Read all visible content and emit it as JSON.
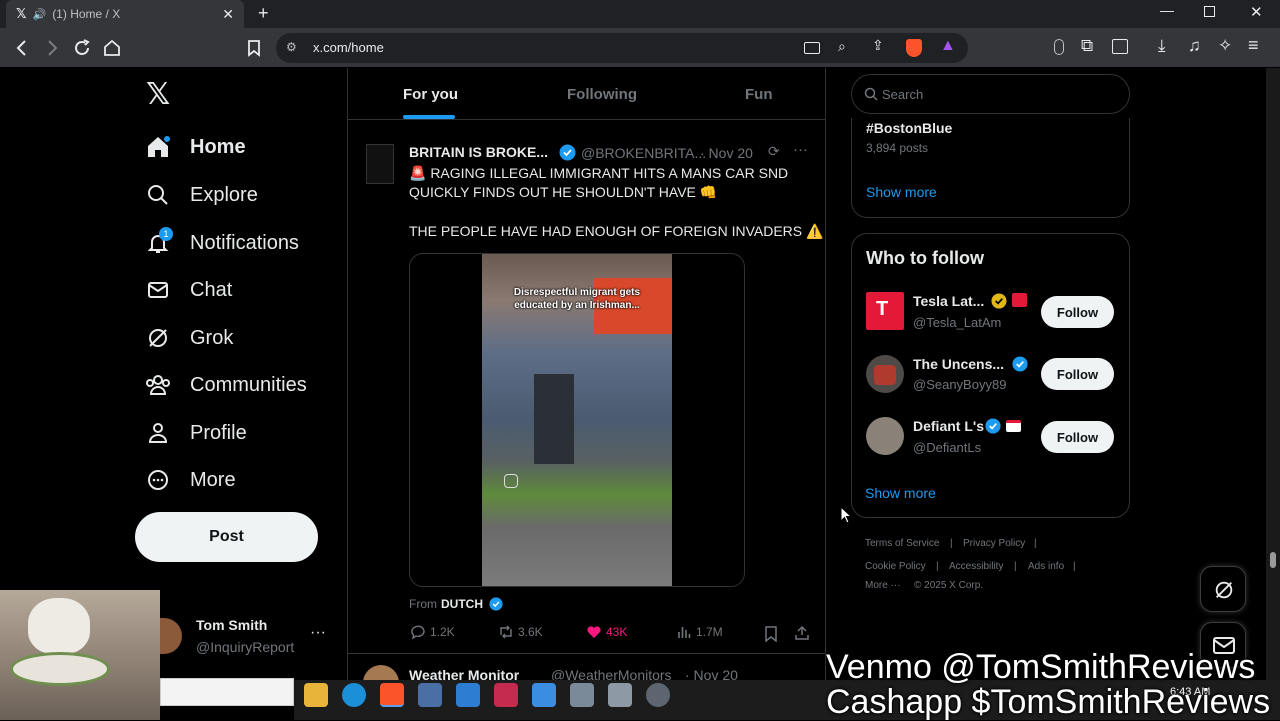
{
  "browser": {
    "tab_title": "(1) Home / X",
    "url": "x.com/home"
  },
  "nav": {
    "items": [
      {
        "label": "Home",
        "icon": "home-icon"
      },
      {
        "label": "Explore",
        "icon": "search-icon"
      },
      {
        "label": "Notifications",
        "icon": "bell-icon",
        "badge": "1"
      },
      {
        "label": "Chat",
        "icon": "envelope-icon"
      },
      {
        "label": "Grok",
        "icon": "grok-icon"
      },
      {
        "label": "Communities",
        "icon": "people-icon"
      },
      {
        "label": "Profile",
        "icon": "person-icon"
      },
      {
        "label": "More",
        "icon": "more-circle-icon"
      }
    ],
    "post_label": "Post",
    "account": {
      "name": "Tom Smith",
      "handle": "@InquiryReport"
    }
  },
  "feed": {
    "tabs": [
      "For you",
      "Following",
      "Fun"
    ],
    "tweet": {
      "author": "BRITAIN IS BROKE...",
      "handle": "@BROKENBRITA...",
      "date": "· Nov 20",
      "line1": "🚨 RAGING ILLEGAL IMMIGRANT HITS A MANS CAR SND QUICKLY FINDS OUT HE SHOULDN'T HAVE 👊",
      "line2": "THE PEOPLE HAVE HAD ENOUGH OF FOREIGN INVADERS ⚠️",
      "video_caption": "Disrespectful migrant gets educated by an Irishman...",
      "from_label": "From",
      "from_name": "DUTCH",
      "replies": "1.2K",
      "reposts": "3.6K",
      "likes": "43K",
      "views": "1.7M"
    },
    "next_tweet": {
      "author": "Weather Monitor",
      "handle": "@WeatherMonitors",
      "date": "· Nov 20"
    }
  },
  "sidebar": {
    "search_placeholder": "Search",
    "trend": {
      "tag": "#BostonBlue",
      "posts": "3,894 posts"
    },
    "show_more": "Show more",
    "who_to_follow": "Who to follow",
    "accounts": [
      {
        "name": "Tesla Lat...",
        "handle": "@Tesla_LatAm",
        "follow": "Follow"
      },
      {
        "name": "The Uncens...",
        "handle": "@SeanyBoyy89",
        "follow": "Follow"
      },
      {
        "name": "Defiant L's",
        "handle": "@DefiantLs",
        "follow": "Follow"
      }
    ],
    "show_more_2": "Show more",
    "footer": {
      "terms": "Terms of Service",
      "privacy": "Privacy Policy",
      "cookie": "Cookie Policy",
      "accessibility": "Accessibility",
      "ads": "Ads info",
      "more": "More ···",
      "copyright": "© 2025 X Corp."
    }
  },
  "overlay": {
    "venmo": "Venmo @TomSmithReviews",
    "cashapp": "Cashapp $TomSmithReviews"
  },
  "taskbar": {
    "time": "6:43 AM"
  },
  "colors": {
    "accent": "#1d9bf0",
    "like": "#f91880",
    "background": "#000000"
  }
}
